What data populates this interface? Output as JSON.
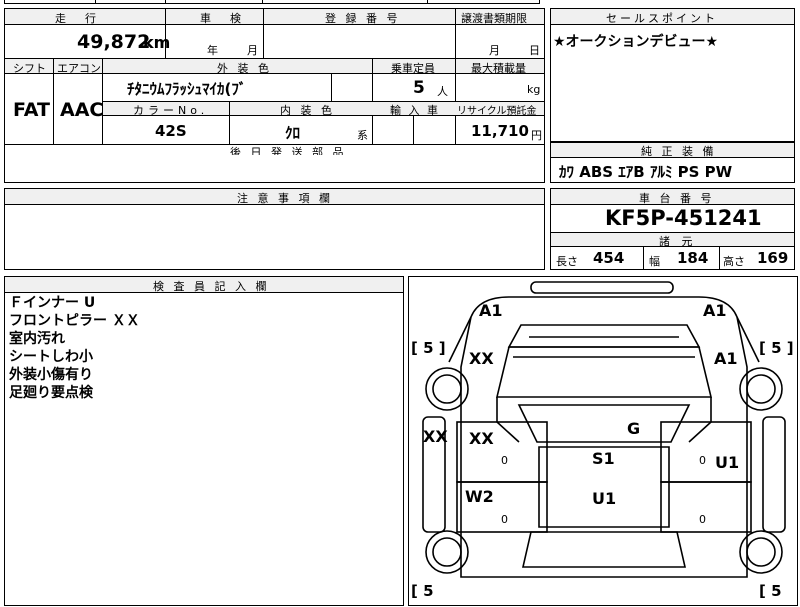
{
  "top_strip": {
    "text": ""
  },
  "headers": {
    "mileage": "走　行",
    "inspection": "車　検",
    "registration": "登 録 番 号",
    "transfer": "譲渡書類期限",
    "sales_point": "セールスポイント",
    "shift": "シフト",
    "aircon": "エアコン",
    "exterior_color": "外 装 色",
    "capacity": "乗車定員",
    "max_load": "最大積載量",
    "color_no": "カラーNo.",
    "interior_color": "内 装 色",
    "import": "輸 入 車",
    "recycle": "リサイクル預託金",
    "later_parts": "後 日 発 送 部 品",
    "genuine": "純 正 装 備",
    "notes": "注 意 事 項 欄",
    "chassis": "車 台 番 号",
    "specs": "諸 元",
    "inspector": "検 査 員 記 入 欄"
  },
  "values": {
    "mileage": "49,872",
    "mileage_unit": "km",
    "inspection_year": "年",
    "inspection_month": "月",
    "transfer_month": "月",
    "transfer_day": "日",
    "sales_point": "★オークションデビュー★",
    "shift": "FAT",
    "aircon": "AAC",
    "exterior_color": "ﾁﾀﾆｳﾑﾌﾗｯｼｭﾏｲｶ(ﾌﾞ",
    "capacity": "5",
    "capacity_unit": "人",
    "max_load_unit": "kg",
    "color_no": "42S",
    "interior_color": "ｸﾛ",
    "interior_suffix": "系",
    "recycle": "11,710",
    "recycle_unit": "円",
    "genuine": "ｶﾜ ABS ｴｱB ｱﾙﾐ PS PW",
    "chassis": "KF5P-451241",
    "length_label": "長さ",
    "length": "454",
    "width_label": "幅",
    "width": "184",
    "height_label": "高さ",
    "height": "169"
  },
  "inspector_notes": [
    "Ｆインナー U",
    "フロントピラー ＸＸ",
    "室内汚れ",
    "シートしわ小",
    "外装小傷有り",
    "足廻り要点検"
  ],
  "diagram": {
    "tire_marks": [
      "[ 5 ]",
      "[ 5 ]",
      "[ 5",
      "[ 5"
    ],
    "marks": [
      {
        "id": "a1-front-left",
        "text": "A1"
      },
      {
        "id": "a1-front-right",
        "text": "A1"
      },
      {
        "id": "xx-fender-left",
        "text": "XX"
      },
      {
        "id": "a1-fender-right",
        "text": "A1"
      },
      {
        "id": "xx-side-left",
        "text": "XX"
      },
      {
        "id": "xx-door-left",
        "text": "XX"
      },
      {
        "id": "g-glass",
        "text": "G"
      },
      {
        "id": "s1-roof",
        "text": "S1"
      },
      {
        "id": "u1-door-right",
        "text": "U1"
      },
      {
        "id": "w2-rear-left",
        "text": "W2"
      },
      {
        "id": "u1-roof",
        "text": "U1"
      },
      {
        "id": "zero-1",
        "text": "0"
      },
      {
        "id": "zero-2",
        "text": "0"
      },
      {
        "id": "zero-3",
        "text": "0"
      },
      {
        "id": "zero-4",
        "text": "0"
      }
    ]
  }
}
